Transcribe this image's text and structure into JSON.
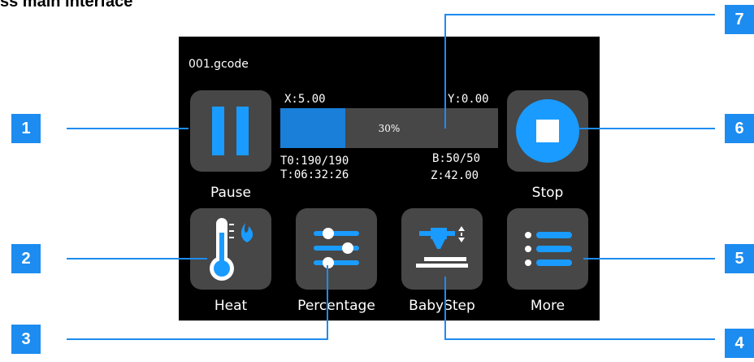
{
  "heading": "ss main interface",
  "screen": {
    "filename": "001.gcode",
    "pos_x": "X:5.00",
    "pos_y": "Y:0.00",
    "pos_z": "Z:42.00",
    "nozzle_temp": "T0:190/190",
    "bed_temp": "B:50/50",
    "time": "T:06:32:26",
    "progress": {
      "text": "30%",
      "value": 0.3
    }
  },
  "buttons": {
    "pause": "Pause",
    "stop": "Stop",
    "heat": "Heat",
    "percentage": "Percentage",
    "babystep": "BabyStep",
    "more": "More"
  },
  "callouts": [
    "1",
    "2",
    "3",
    "4",
    "5",
    "6",
    "7"
  ],
  "colors": {
    "accent": "#1a9bff",
    "tile": "#474747",
    "callout": "#1d8cf0",
    "leader": "#1d8cf0"
  },
  "icons": {
    "pause": "pause-icon",
    "stop": "stop-icon",
    "heat": "thermometer-flame-icon",
    "percentage": "sliders-icon",
    "babystep": "nozzle-bed-icon",
    "more": "list-icon"
  }
}
